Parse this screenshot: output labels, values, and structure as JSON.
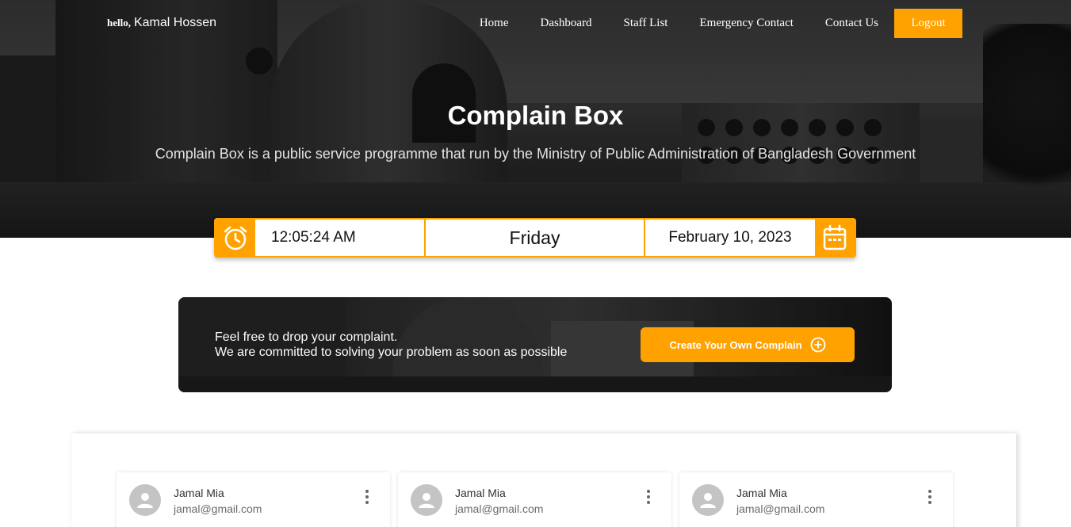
{
  "header": {
    "greeting": "hello,",
    "user_name": "Kamal Hossen",
    "nav": [
      {
        "label": "Home"
      },
      {
        "label": "Dashboard"
      },
      {
        "label": "Staff List"
      },
      {
        "label": "Emergency Contact"
      },
      {
        "label": "Contact Us"
      }
    ],
    "logout_label": "Logout"
  },
  "hero": {
    "title": "Complain Box",
    "subtitle": "Complain Box is a public service programme that run by the Ministry of Public Administration of Bangladesh Government"
  },
  "clock": {
    "time": "12:05:24 AM",
    "day": "Friday",
    "date": "February 10, 2023",
    "left_icon": "alarm-clock-icon",
    "right_icon": "calendar-icon"
  },
  "cta": {
    "line1": "Feel free to drop your complaint.",
    "line2": "We are committed to solving your problem as soon as possible",
    "button_label": "Create Your Own Complain",
    "button_icon": "plus-circle-icon"
  },
  "complaints": [
    {
      "name": "Jamal Mia",
      "email": "jamal@gmail.com"
    },
    {
      "name": "Jamal Mia",
      "email": "jamal@gmail.com"
    },
    {
      "name": "Jamal Mia",
      "email": "jamal@gmail.com"
    }
  ],
  "colors": {
    "accent": "#ffa200",
    "text_dark": "#111111"
  }
}
